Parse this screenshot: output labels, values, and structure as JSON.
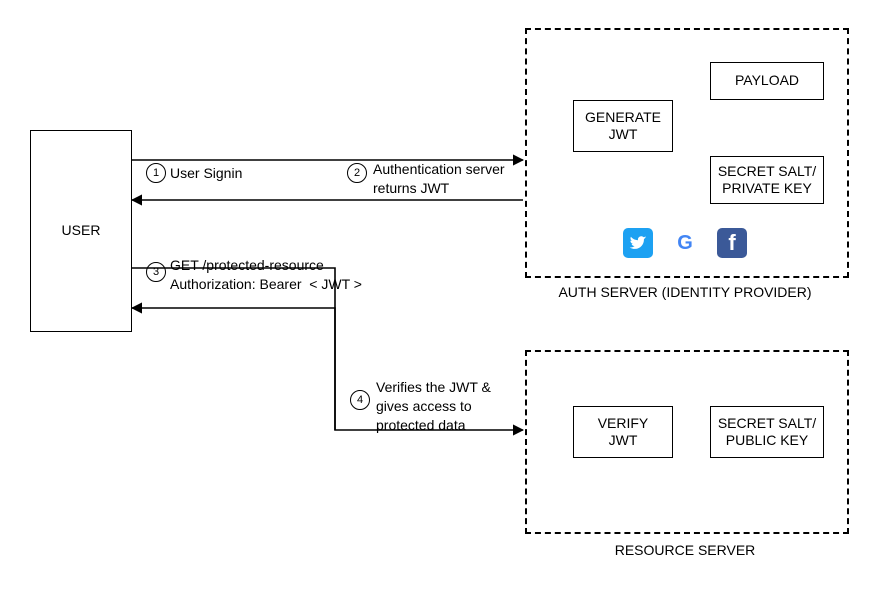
{
  "user": {
    "label": "USER"
  },
  "auth_server": {
    "caption": "AUTH SERVER (IDENTITY PROVIDER)",
    "generate_jwt": "GENERATE\nJWT",
    "payload": "PAYLOAD",
    "secret_private": "SECRET SALT/\nPRIVATE KEY"
  },
  "resource_server": {
    "caption": "RESOURCE SERVER",
    "verify_jwt": "VERIFY\nJWT",
    "secret_public": "SECRET SALT/\nPUBLIC KEY"
  },
  "steps": {
    "s1": {
      "num": "1",
      "text": "User Signin"
    },
    "s2": {
      "num": "2",
      "text": "Authentication server\nreturns JWT"
    },
    "s3": {
      "num": "3",
      "text": "GET /protected-resource\nAuthorization: Bearer  < JWT >"
    },
    "s4": {
      "num": "4",
      "text": "Verifies the JWT &\ngives access to\nprotected data"
    }
  },
  "providers": {
    "twitter": "twitter-icon",
    "google": "google-icon",
    "facebook": "facebook-icon"
  }
}
